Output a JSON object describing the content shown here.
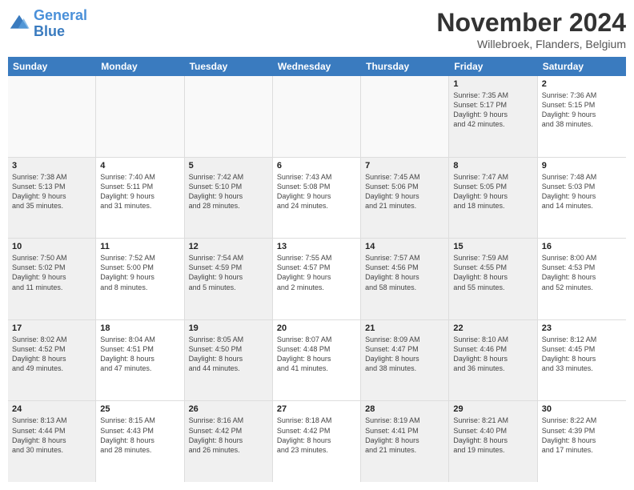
{
  "logo": {
    "line1": "General",
    "line2": "Blue"
  },
  "title": "November 2024",
  "subtitle": "Willebroek, Flanders, Belgium",
  "header_days": [
    "Sunday",
    "Monday",
    "Tuesday",
    "Wednesday",
    "Thursday",
    "Friday",
    "Saturday"
  ],
  "weeks": [
    [
      {
        "day": "",
        "info": "",
        "empty": true
      },
      {
        "day": "",
        "info": "",
        "empty": true
      },
      {
        "day": "",
        "info": "",
        "empty": true
      },
      {
        "day": "",
        "info": "",
        "empty": true
      },
      {
        "day": "",
        "info": "",
        "empty": true
      },
      {
        "day": "1",
        "info": "Sunrise: 7:35 AM\nSunset: 5:17 PM\nDaylight: 9 hours\nand 42 minutes.",
        "shaded": true
      },
      {
        "day": "2",
        "info": "Sunrise: 7:36 AM\nSunset: 5:15 PM\nDaylight: 9 hours\nand 38 minutes."
      }
    ],
    [
      {
        "day": "3",
        "info": "Sunrise: 7:38 AM\nSunset: 5:13 PM\nDaylight: 9 hours\nand 35 minutes.",
        "shaded": true
      },
      {
        "day": "4",
        "info": "Sunrise: 7:40 AM\nSunset: 5:11 PM\nDaylight: 9 hours\nand 31 minutes."
      },
      {
        "day": "5",
        "info": "Sunrise: 7:42 AM\nSunset: 5:10 PM\nDaylight: 9 hours\nand 28 minutes.",
        "shaded": true
      },
      {
        "day": "6",
        "info": "Sunrise: 7:43 AM\nSunset: 5:08 PM\nDaylight: 9 hours\nand 24 minutes."
      },
      {
        "day": "7",
        "info": "Sunrise: 7:45 AM\nSunset: 5:06 PM\nDaylight: 9 hours\nand 21 minutes.",
        "shaded": true
      },
      {
        "day": "8",
        "info": "Sunrise: 7:47 AM\nSunset: 5:05 PM\nDaylight: 9 hours\nand 18 minutes.",
        "shaded": true
      },
      {
        "day": "9",
        "info": "Sunrise: 7:48 AM\nSunset: 5:03 PM\nDaylight: 9 hours\nand 14 minutes."
      }
    ],
    [
      {
        "day": "10",
        "info": "Sunrise: 7:50 AM\nSunset: 5:02 PM\nDaylight: 9 hours\nand 11 minutes.",
        "shaded": true
      },
      {
        "day": "11",
        "info": "Sunrise: 7:52 AM\nSunset: 5:00 PM\nDaylight: 9 hours\nand 8 minutes."
      },
      {
        "day": "12",
        "info": "Sunrise: 7:54 AM\nSunset: 4:59 PM\nDaylight: 9 hours\nand 5 minutes.",
        "shaded": true
      },
      {
        "day": "13",
        "info": "Sunrise: 7:55 AM\nSunset: 4:57 PM\nDaylight: 9 hours\nand 2 minutes."
      },
      {
        "day": "14",
        "info": "Sunrise: 7:57 AM\nSunset: 4:56 PM\nDaylight: 8 hours\nand 58 minutes.",
        "shaded": true
      },
      {
        "day": "15",
        "info": "Sunrise: 7:59 AM\nSunset: 4:55 PM\nDaylight: 8 hours\nand 55 minutes.",
        "shaded": true
      },
      {
        "day": "16",
        "info": "Sunrise: 8:00 AM\nSunset: 4:53 PM\nDaylight: 8 hours\nand 52 minutes."
      }
    ],
    [
      {
        "day": "17",
        "info": "Sunrise: 8:02 AM\nSunset: 4:52 PM\nDaylight: 8 hours\nand 49 minutes.",
        "shaded": true
      },
      {
        "day": "18",
        "info": "Sunrise: 8:04 AM\nSunset: 4:51 PM\nDaylight: 8 hours\nand 47 minutes."
      },
      {
        "day": "19",
        "info": "Sunrise: 8:05 AM\nSunset: 4:50 PM\nDaylight: 8 hours\nand 44 minutes.",
        "shaded": true
      },
      {
        "day": "20",
        "info": "Sunrise: 8:07 AM\nSunset: 4:48 PM\nDaylight: 8 hours\nand 41 minutes."
      },
      {
        "day": "21",
        "info": "Sunrise: 8:09 AM\nSunset: 4:47 PM\nDaylight: 8 hours\nand 38 minutes.",
        "shaded": true
      },
      {
        "day": "22",
        "info": "Sunrise: 8:10 AM\nSunset: 4:46 PM\nDaylight: 8 hours\nand 36 minutes.",
        "shaded": true
      },
      {
        "day": "23",
        "info": "Sunrise: 8:12 AM\nSunset: 4:45 PM\nDaylight: 8 hours\nand 33 minutes."
      }
    ],
    [
      {
        "day": "24",
        "info": "Sunrise: 8:13 AM\nSunset: 4:44 PM\nDaylight: 8 hours\nand 30 minutes.",
        "shaded": true
      },
      {
        "day": "25",
        "info": "Sunrise: 8:15 AM\nSunset: 4:43 PM\nDaylight: 8 hours\nand 28 minutes."
      },
      {
        "day": "26",
        "info": "Sunrise: 8:16 AM\nSunset: 4:42 PM\nDaylight: 8 hours\nand 26 minutes.",
        "shaded": true
      },
      {
        "day": "27",
        "info": "Sunrise: 8:18 AM\nSunset: 4:42 PM\nDaylight: 8 hours\nand 23 minutes."
      },
      {
        "day": "28",
        "info": "Sunrise: 8:19 AM\nSunset: 4:41 PM\nDaylight: 8 hours\nand 21 minutes.",
        "shaded": true
      },
      {
        "day": "29",
        "info": "Sunrise: 8:21 AM\nSunset: 4:40 PM\nDaylight: 8 hours\nand 19 minutes.",
        "shaded": true
      },
      {
        "day": "30",
        "info": "Sunrise: 8:22 AM\nSunset: 4:39 PM\nDaylight: 8 hours\nand 17 minutes."
      }
    ]
  ]
}
